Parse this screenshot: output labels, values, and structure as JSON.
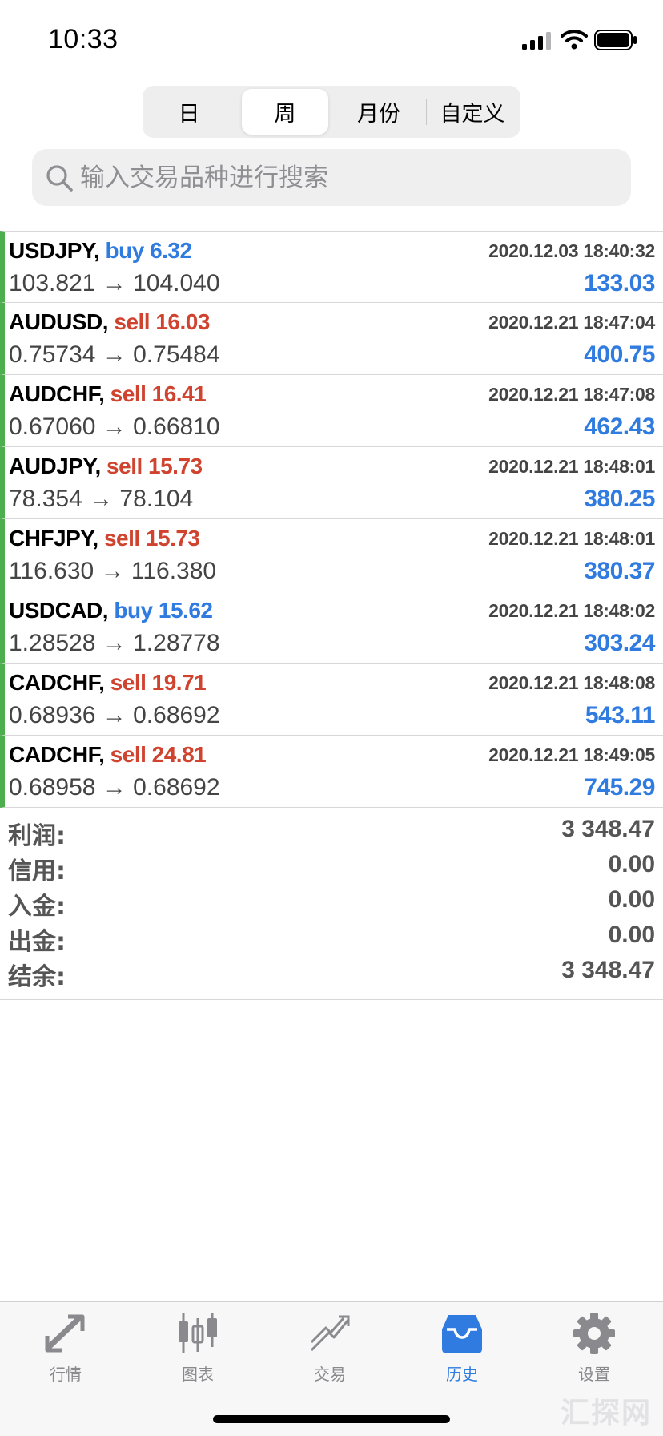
{
  "status_bar": {
    "time": "10:33"
  },
  "period_tabs": [
    {
      "label": "日",
      "active": false
    },
    {
      "label": "周",
      "active": true
    },
    {
      "label": "月份",
      "active": false
    },
    {
      "label": "自定义",
      "active": false
    }
  ],
  "search": {
    "placeholder": "输入交易品种进行搜索",
    "value": ""
  },
  "trades": [
    {
      "symbol": "USDJPY,",
      "action": "buy",
      "volume": "6.32",
      "time": "2020.12.03 18:40:32",
      "prices": "103.821 → 104.040",
      "profit": "133.03"
    },
    {
      "symbol": "AUDUSD,",
      "action": "sell",
      "volume": "16.03",
      "time": "2020.12.21 18:47:04",
      "prices": "0.75734 → 0.75484",
      "profit": "400.75"
    },
    {
      "symbol": "AUDCHF,",
      "action": "sell",
      "volume": "16.41",
      "time": "2020.12.21 18:47:08",
      "prices": "0.67060 → 0.66810",
      "profit": "462.43"
    },
    {
      "symbol": "AUDJPY,",
      "action": "sell",
      "volume": "15.73",
      "time": "2020.12.21 18:48:01",
      "prices": "78.354 → 78.104",
      "profit": "380.25"
    },
    {
      "symbol": "CHFJPY,",
      "action": "sell",
      "volume": "15.73",
      "time": "2020.12.21 18:48:01",
      "prices": "116.630 → 116.380",
      "profit": "380.37"
    },
    {
      "symbol": "USDCAD,",
      "action": "buy",
      "volume": "15.62",
      "time": "2020.12.21 18:48:02",
      "prices": "1.28528 → 1.28778",
      "profit": "303.24"
    },
    {
      "symbol": "CADCHF,",
      "action": "sell",
      "volume": "19.71",
      "time": "2020.12.21 18:48:08",
      "prices": "0.68936 → 0.68692",
      "profit": "543.11"
    },
    {
      "symbol": "CADCHF,",
      "action": "sell",
      "volume": "24.81",
      "time": "2020.12.21 18:49:05",
      "prices": "0.68958 → 0.68692",
      "profit": "745.29"
    }
  ],
  "summary": [
    {
      "label": "利润:",
      "value": "3 348.47"
    },
    {
      "label": "信用:",
      "value": "0.00"
    },
    {
      "label": "入金:",
      "value": "0.00"
    },
    {
      "label": "出金:",
      "value": "0.00"
    },
    {
      "label": "结余:",
      "value": "3 348.47"
    }
  ],
  "tab_bar": [
    {
      "label": "行情",
      "icon": "quotes-icon",
      "active": false
    },
    {
      "label": "图表",
      "icon": "chart-icon",
      "active": false
    },
    {
      "label": "交易",
      "icon": "trade-icon",
      "active": false
    },
    {
      "label": "历史",
      "icon": "history-icon",
      "active": true
    },
    {
      "label": "设置",
      "icon": "settings-icon",
      "active": false
    }
  ],
  "colors": {
    "accent": "#2f7be0",
    "sell": "#d0432f",
    "buy": "#2f7be0",
    "row_marker": "#4cae4c"
  },
  "watermark": "汇探网"
}
